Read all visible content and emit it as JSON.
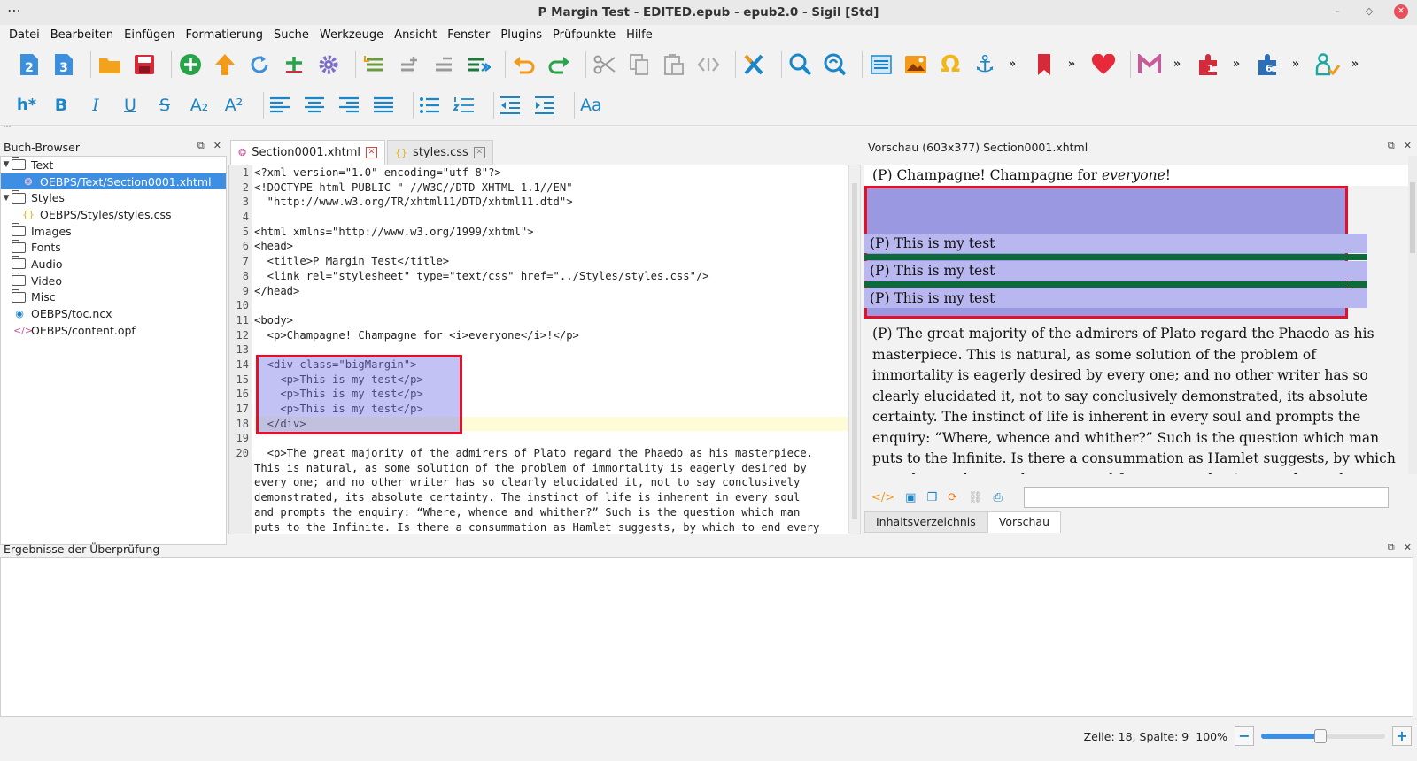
{
  "window": {
    "title": "P Margin Test - EDITED.epub - epub2.0 - Sigil [Std]"
  },
  "menu": [
    {
      "label": "Datei"
    },
    {
      "label": "Bearbeiten"
    },
    {
      "label": "Einfügen"
    },
    {
      "label": "Formatierung"
    },
    {
      "label": "Suche"
    },
    {
      "label": "Werkzeuge"
    },
    {
      "label": "Ansicht"
    },
    {
      "label": "Fenster"
    },
    {
      "label": "Plugins"
    },
    {
      "label": "Prüfpunkte"
    },
    {
      "label": "Hilfe"
    }
  ],
  "toolbar": {
    "epub2_label": "2",
    "epub3_label": "3",
    "more": "»",
    "heading_label": "h*",
    "bold_label": "B",
    "italic_label": "I",
    "underline_label": "U",
    "strike_label": "S",
    "sub_label": "A₂",
    "sup_label": "A²",
    "case_label": "Aa",
    "plugin_badge_1": "1",
    "plugin_badge_6": "6"
  },
  "bookbrowser": {
    "title": "Buch-Browser",
    "items": [
      {
        "label": "Text",
        "type": "folder"
      },
      {
        "label": "OEBPS/Text/Section0001.xhtml",
        "type": "xhtml",
        "selected": true
      },
      {
        "label": "Styles",
        "type": "folder"
      },
      {
        "label": "OEBPS/Styles/styles.css",
        "type": "css"
      },
      {
        "label": "Images",
        "type": "folder"
      },
      {
        "label": "Fonts",
        "type": "folder"
      },
      {
        "label": "Audio",
        "type": "folder"
      },
      {
        "label": "Video",
        "type": "folder"
      },
      {
        "label": "Misc",
        "type": "folder"
      },
      {
        "label": "OEBPS/toc.ncx",
        "type": "ncx"
      },
      {
        "label": "OEBPS/content.opf",
        "type": "opf"
      }
    ]
  },
  "editor": {
    "tabs": [
      {
        "label": "Section0001.xhtml",
        "active": true
      },
      {
        "label": "styles.css",
        "active": false
      }
    ],
    "line_numbers": [
      "1",
      "2",
      "3",
      "4",
      "5",
      "6",
      "7",
      "8",
      "9",
      "10",
      "11",
      "12",
      "13",
      "14",
      "15",
      "16",
      "17",
      "18",
      "19",
      "20",
      "",
      "",
      "",
      "",
      "",
      ""
    ],
    "lines": [
      "<?xml version=\"1.0\" encoding=\"utf-8\"?>",
      "<!DOCTYPE html PUBLIC \"-//W3C//DTD XHTML 1.1//EN\"",
      "  \"http://www.w3.org/TR/xhtml11/DTD/xhtml11.dtd\">",
      "",
      "<html xmlns=\"http://www.w3.org/1999/xhtml\">",
      "<head>",
      "  <title>P Margin Test</title>",
      "  <link rel=\"stylesheet\" type=\"text/css\" href=\"../Styles/styles.css\"/>",
      "</head>",
      "",
      "<body>",
      "  <p>Champagne! Champagne for <i>everyone</i>!</p>",
      "",
      "  <div class=\"bigMargin\">",
      "    <p>This is my test</p>",
      "    <p>This is my test</p>",
      "    <p>This is my test</p>",
      "  </div>",
      "",
      "  <p>The great majority of the admirers of Plato regard the Phaedo as his masterpiece.",
      "This is natural, as some solution of the problem of immortality is eagerly desired by",
      "every one; and no other writer has so clearly elucidated it, not to say conclusively",
      "demonstrated, its absolute certainty. The instinct of life is inherent in every soul",
      "and prompts the enquiry: “Where, whence and whither?” Such is the question which man",
      "puts to the Infinite. Is there a consummation as Hamlet suggests, by which to end every"
    ]
  },
  "preview": {
    "title": "Vorschau (603x377) Section0001.xhtml",
    "first_line": "(P) Champagne! Champagne for ",
    "first_line_em": "everyone",
    "first_line_end": "!",
    "test_lines": [
      "(P) This is my test",
      "(P) This is my test",
      "(P) This is my test"
    ],
    "paragraph_lines": [
      "(P) The great majority of the admirers of Plato regard the Phaedo as his",
      "masterpiece. This is natural, as some solution of the problem of",
      "immortality is eagerly desired by every one; and no other writer has so",
      "clearly elucidated it, not to say conclusively demonstrated, its absolute",
      "certainty. The instinct of life is inherent in every soul and prompts the",
      "enquiry: “Where, whence and whither?” Such is the question which man",
      "puts to the Infinite. Is there a consummation as Hamlet suggests, by which",
      "to end every heart-ache, untoward fortune or calamity — a sleep when “we"
    ],
    "bottom_tabs": [
      {
        "label": "Inhaltsverzeichnis",
        "active": false
      },
      {
        "label": "Vorschau",
        "active": true
      }
    ]
  },
  "results": {
    "title": "Ergebnisse der Überprüfung"
  },
  "status": {
    "position": "Zeile: 18, Spalte: 9",
    "zoom": "100%",
    "zoom_fraction": 0.48
  }
}
